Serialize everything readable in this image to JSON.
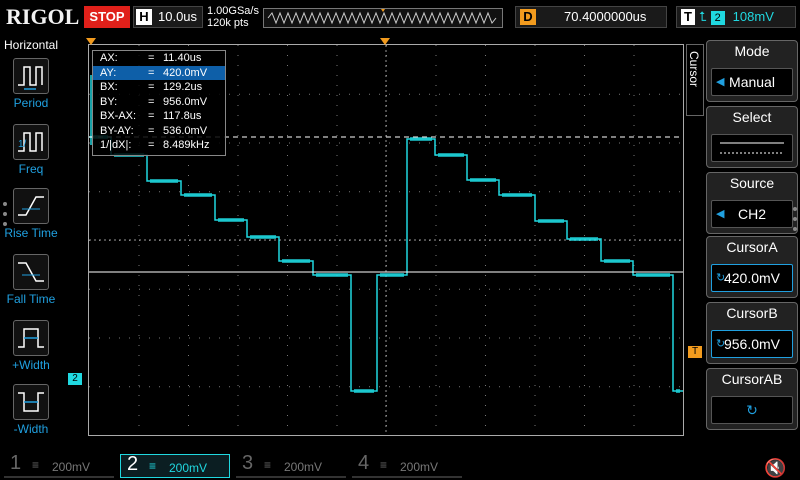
{
  "topbar": {
    "logo": "RIGOL",
    "run_state": "STOP",
    "horizontal_key": "H",
    "timebase": "10.0us",
    "sample_rate": "1.00GSa/s",
    "memory_depth": "120k pts",
    "delay_key": "D",
    "delay": "70.4000000us",
    "trigger_key": "T",
    "trigger_edge_icon": "rising-edge-icon",
    "trigger_source": "2",
    "trigger_level": "108mV"
  },
  "left_panel": {
    "title": "Horizontal",
    "items": [
      {
        "label": "Period",
        "icon": "period-icon"
      },
      {
        "label": "Freq",
        "icon": "frequency-icon"
      },
      {
        "label": "Rise Time",
        "icon": "rise-time-icon"
      },
      {
        "label": "Fall Time",
        "icon": "fall-time-icon"
      },
      {
        "label": "+Width",
        "icon": "positive-width-icon"
      },
      {
        "label": "-Width",
        "icon": "negative-width-icon"
      }
    ]
  },
  "cursor_readout": [
    {
      "key": "AX:",
      "value": "11.40us"
    },
    {
      "key": "AY:",
      "value": "420.0mV",
      "selected": true
    },
    {
      "key": "BX:",
      "value": "129.2us"
    },
    {
      "key": "BY:",
      "value": "956.0mV"
    },
    {
      "key": "BX-AX:",
      "value": "117.8us"
    },
    {
      "key": "BY-AY:",
      "value": "536.0mV"
    },
    {
      "key": "1/|dX|:",
      "value": "8.489kHz"
    }
  ],
  "right_panel": {
    "tab_label": "Cursor",
    "buttons": [
      {
        "title": "Mode",
        "value": "Manual",
        "has_arrow": true
      },
      {
        "title": "Select",
        "value": "",
        "has_arrow": false
      },
      {
        "title": "Source",
        "value": "CH2",
        "has_arrow": true
      },
      {
        "title": "CursorA",
        "value": "420.0mV",
        "has_arrow": false
      },
      {
        "title": "CursorB",
        "value": "956.0mV",
        "has_arrow": false
      },
      {
        "title": "CursorAB",
        "value": "",
        "has_arrow": false
      }
    ]
  },
  "markers": {
    "ch2_marker": "2",
    "trigger_marker": "T"
  },
  "channels": [
    {
      "num": "1",
      "scale": "200mV",
      "color": "#e6c200",
      "active": false
    },
    {
      "num": "2",
      "scale": "200mV",
      "color": "#20d8e0",
      "active": true
    },
    {
      "num": "3",
      "scale": "200mV",
      "color": "#d040c0",
      "active": false
    },
    {
      "num": "4",
      "scale": "200mV",
      "color": "#3060e0",
      "active": false
    }
  ],
  "colors": {
    "ch2": "#20d8e0",
    "accent": "#0e5fa8",
    "trigger": "#f29b1e",
    "stop": "#e0201a"
  }
}
